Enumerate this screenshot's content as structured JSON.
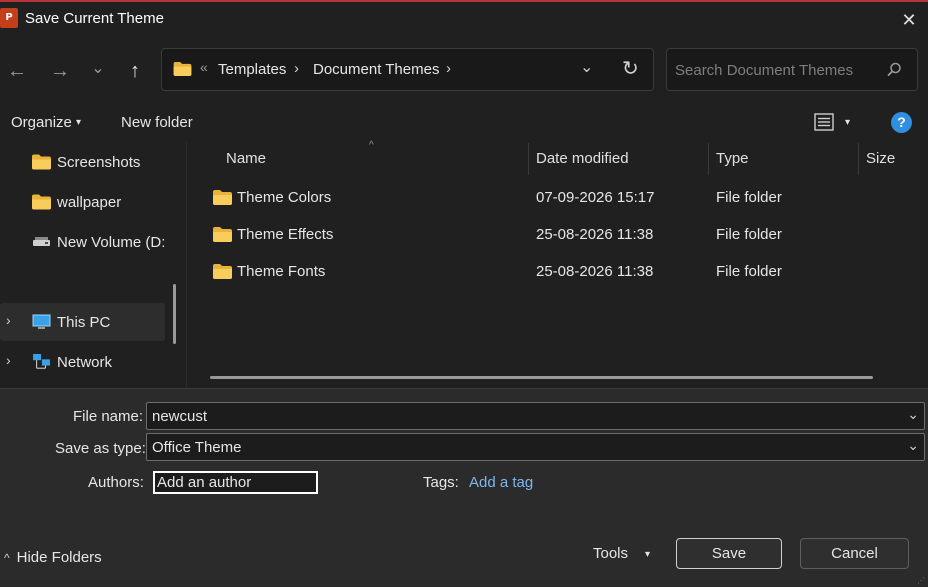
{
  "window": {
    "title": "Save Current Theme",
    "app_icon_letter": "P",
    "close_glyph": "✕"
  },
  "nav": {
    "back_glyph": "←",
    "forward_glyph": "→",
    "recent_glyph": "⌄",
    "up_glyph": "↑"
  },
  "address": {
    "overflow_glyph": "«",
    "crumbs": [
      "Templates",
      "Document Themes"
    ],
    "separator": "›",
    "dropdown_glyph": "⌄",
    "refresh_glyph": "↻"
  },
  "search": {
    "placeholder": "Search Document Themes"
  },
  "toolbar": {
    "organize_label": "Organize",
    "new_folder_label": "New folder",
    "caret": "▾",
    "help_glyph": "?"
  },
  "nav_pane": {
    "items": [
      {
        "label": "Screenshots",
        "icon": "folder-icon"
      },
      {
        "label": "wallpaper",
        "icon": "folder-icon"
      },
      {
        "label": "New Volume (D:",
        "icon": "drive-icon"
      },
      {
        "label": "This PC",
        "icon": "computer-icon",
        "expandable": true
      },
      {
        "label": "Network",
        "icon": "network-icon",
        "expandable": true
      }
    ],
    "chevron": "›"
  },
  "file_list": {
    "columns": [
      "Name",
      "Date modified",
      "Type",
      "Size"
    ],
    "sort_glyph": "^",
    "rows": [
      {
        "name": "Theme Colors",
        "date": "07-09-2026 15:17",
        "type": "File folder"
      },
      {
        "name": "Theme Effects",
        "date": "25-08-2026 11:38",
        "type": "File folder"
      },
      {
        "name": "Theme Fonts",
        "date": "25-08-2026 11:38",
        "type": "File folder"
      }
    ]
  },
  "form": {
    "file_name_label": "File name:",
    "file_name_value": "newcust",
    "save_type_label": "Save as type:",
    "save_type_value": "Office Theme",
    "authors_label": "Authors:",
    "authors_placeholder": "Add an author",
    "tags_label": "Tags:",
    "tags_link": "Add a tag",
    "combo_arrow": "⌄"
  },
  "footer": {
    "hide_folders_label": "Hide Folders",
    "hide_folders_glyph": "^",
    "tools_label": "Tools",
    "save_label": "Save",
    "cancel_label": "Cancel"
  },
  "colors": {
    "background": "#202020",
    "panel": "#2b2b2b",
    "accent": "#7eb6ee",
    "folder": "#f4c44f",
    "help": "#2f8fe0"
  }
}
